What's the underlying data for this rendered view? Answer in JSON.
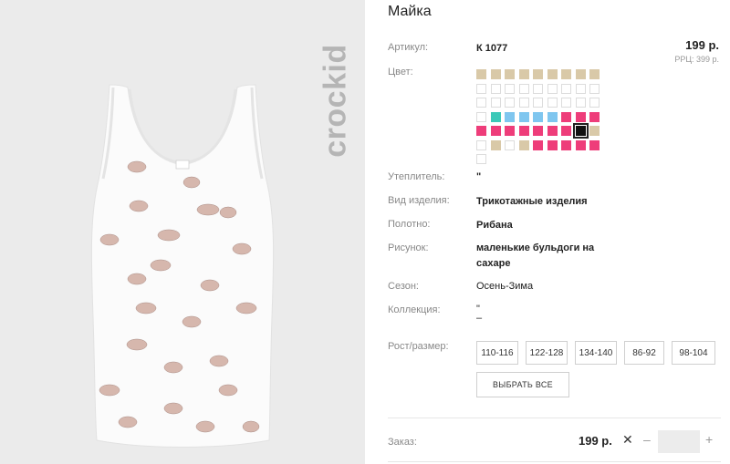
{
  "brand": {
    "logo_text": "crockid"
  },
  "product": {
    "title": "Майка",
    "price": "199 р.",
    "rrp": "РРЦ: 399 р."
  },
  "labels": {
    "article": "Артикул:",
    "color": "Цвет:",
    "insulation": "Утеплитель:",
    "product_type": "Вид изделия:",
    "fabric": "Полотно:",
    "print": "Рисунок:",
    "season": "Сезон:",
    "collection": "Коллекция:",
    "size": "Рост/размер:",
    "order": "Заказ:"
  },
  "values": {
    "article": "К 1077",
    "insulation": "\"",
    "product_type": "Трикотажные изделия",
    "fabric": "Рибана",
    "print_line1": "маленькие бульдоги на",
    "print_line2": "сахаре",
    "season": "Осень-Зима",
    "collection_line1": "\"",
    "collection_line2": "–"
  },
  "colors": {
    "beige": "#d9c9a8",
    "teal": "#3cc9b8",
    "blue": "#7fc6ef",
    "pink": "#ee3d7a",
    "black": "#111111",
    "empty": "#ffffff"
  },
  "color_grid": [
    [
      "beige",
      "beige",
      "beige",
      "beige",
      "beige",
      "beige",
      "beige",
      "beige",
      "beige"
    ],
    [
      "empty",
      "empty",
      "empty",
      "empty",
      "empty",
      "empty",
      "empty",
      "empty",
      "empty"
    ],
    [
      "empty",
      "empty",
      "empty",
      "empty",
      "empty",
      "empty",
      "empty",
      "empty",
      "empty"
    ],
    [
      "empty",
      "teal",
      "blue",
      "blue",
      "blue",
      "blue",
      "pink",
      "pink",
      "pink"
    ],
    [
      "pink",
      "pink",
      "pink",
      "pink",
      "pink",
      "pink",
      "pink",
      "black",
      "beige"
    ],
    [
      "empty",
      "beige",
      "empty",
      "beige",
      "pink",
      "pink",
      "pink",
      "pink",
      "pink"
    ],
    [
      "empty"
    ]
  ],
  "selected_color": {
    "row": 4,
    "col": 7
  },
  "sizes": [
    "110-116",
    "122-128",
    "134-140",
    "86-92",
    "98-104"
  ],
  "select_all_label": "ВЫБРАТЬ ВСЕ",
  "order": {
    "price": "199 р.",
    "remove_symbol": "✕",
    "minus": "–",
    "plus": "+",
    "quantity": ""
  }
}
